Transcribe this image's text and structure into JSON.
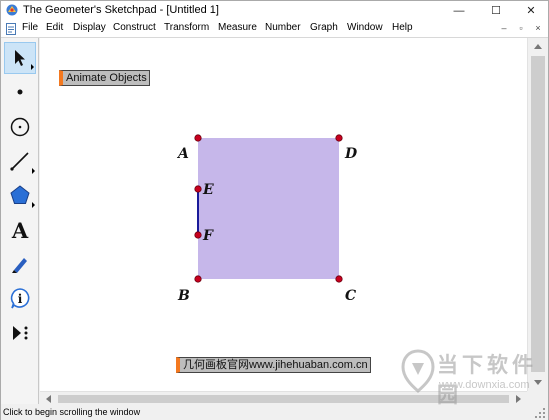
{
  "window": {
    "title": "The Geometer's Sketchpad - [Untitled 1]",
    "minimize_glyph": "—",
    "maximize_glyph": "☐",
    "close_glyph": "✕",
    "app_icon": "sketchpad-logo-icon"
  },
  "menubar": {
    "doc_icon": "document-icon",
    "items": [
      "File",
      "Edit",
      "Display",
      "Construct",
      "Transform",
      "Measure",
      "Number",
      "Graph",
      "Window",
      "Help"
    ],
    "mdi_minimize": "–",
    "mdi_restore": "▫",
    "mdi_close": "×"
  },
  "toolbar": {
    "tools": [
      {
        "name": "arrow-tool",
        "icon": "arrow-icon",
        "selected": true
      },
      {
        "name": "point-tool",
        "icon": "point-icon"
      },
      {
        "name": "compass-tool",
        "icon": "compass-circle-icon"
      },
      {
        "name": "straightedge-tool",
        "icon": "straightedge-line-icon"
      },
      {
        "name": "polygon-tool",
        "icon": "polygon-icon"
      },
      {
        "name": "text-tool",
        "icon": "text-a-icon",
        "glyph": "A"
      },
      {
        "name": "marker-tool",
        "icon": "marker-pen-icon"
      },
      {
        "name": "information-tool",
        "icon": "info-icon",
        "glyph": "i"
      },
      {
        "name": "custom-tool",
        "icon": "custom-tool-icon"
      }
    ]
  },
  "canvas": {
    "animate_button": "Animate Objects",
    "website_button": "几何画板官网www.jihehuaban.com.cn",
    "points": {
      "A": "A",
      "B": "B",
      "C": "C",
      "D": "D",
      "E": "E",
      "F": "F"
    },
    "colors": {
      "polygon_fill": "#c6b7ea",
      "point": "#c8001e",
      "segment_ef": "#1a1a9a",
      "button_handle": "#f47920"
    }
  },
  "status": {
    "text": "Click to begin scrolling the window"
  },
  "watermark": {
    "title": "当下软件园",
    "url": "www.downxia.com",
    "logo": "downxia-logo-icon"
  }
}
